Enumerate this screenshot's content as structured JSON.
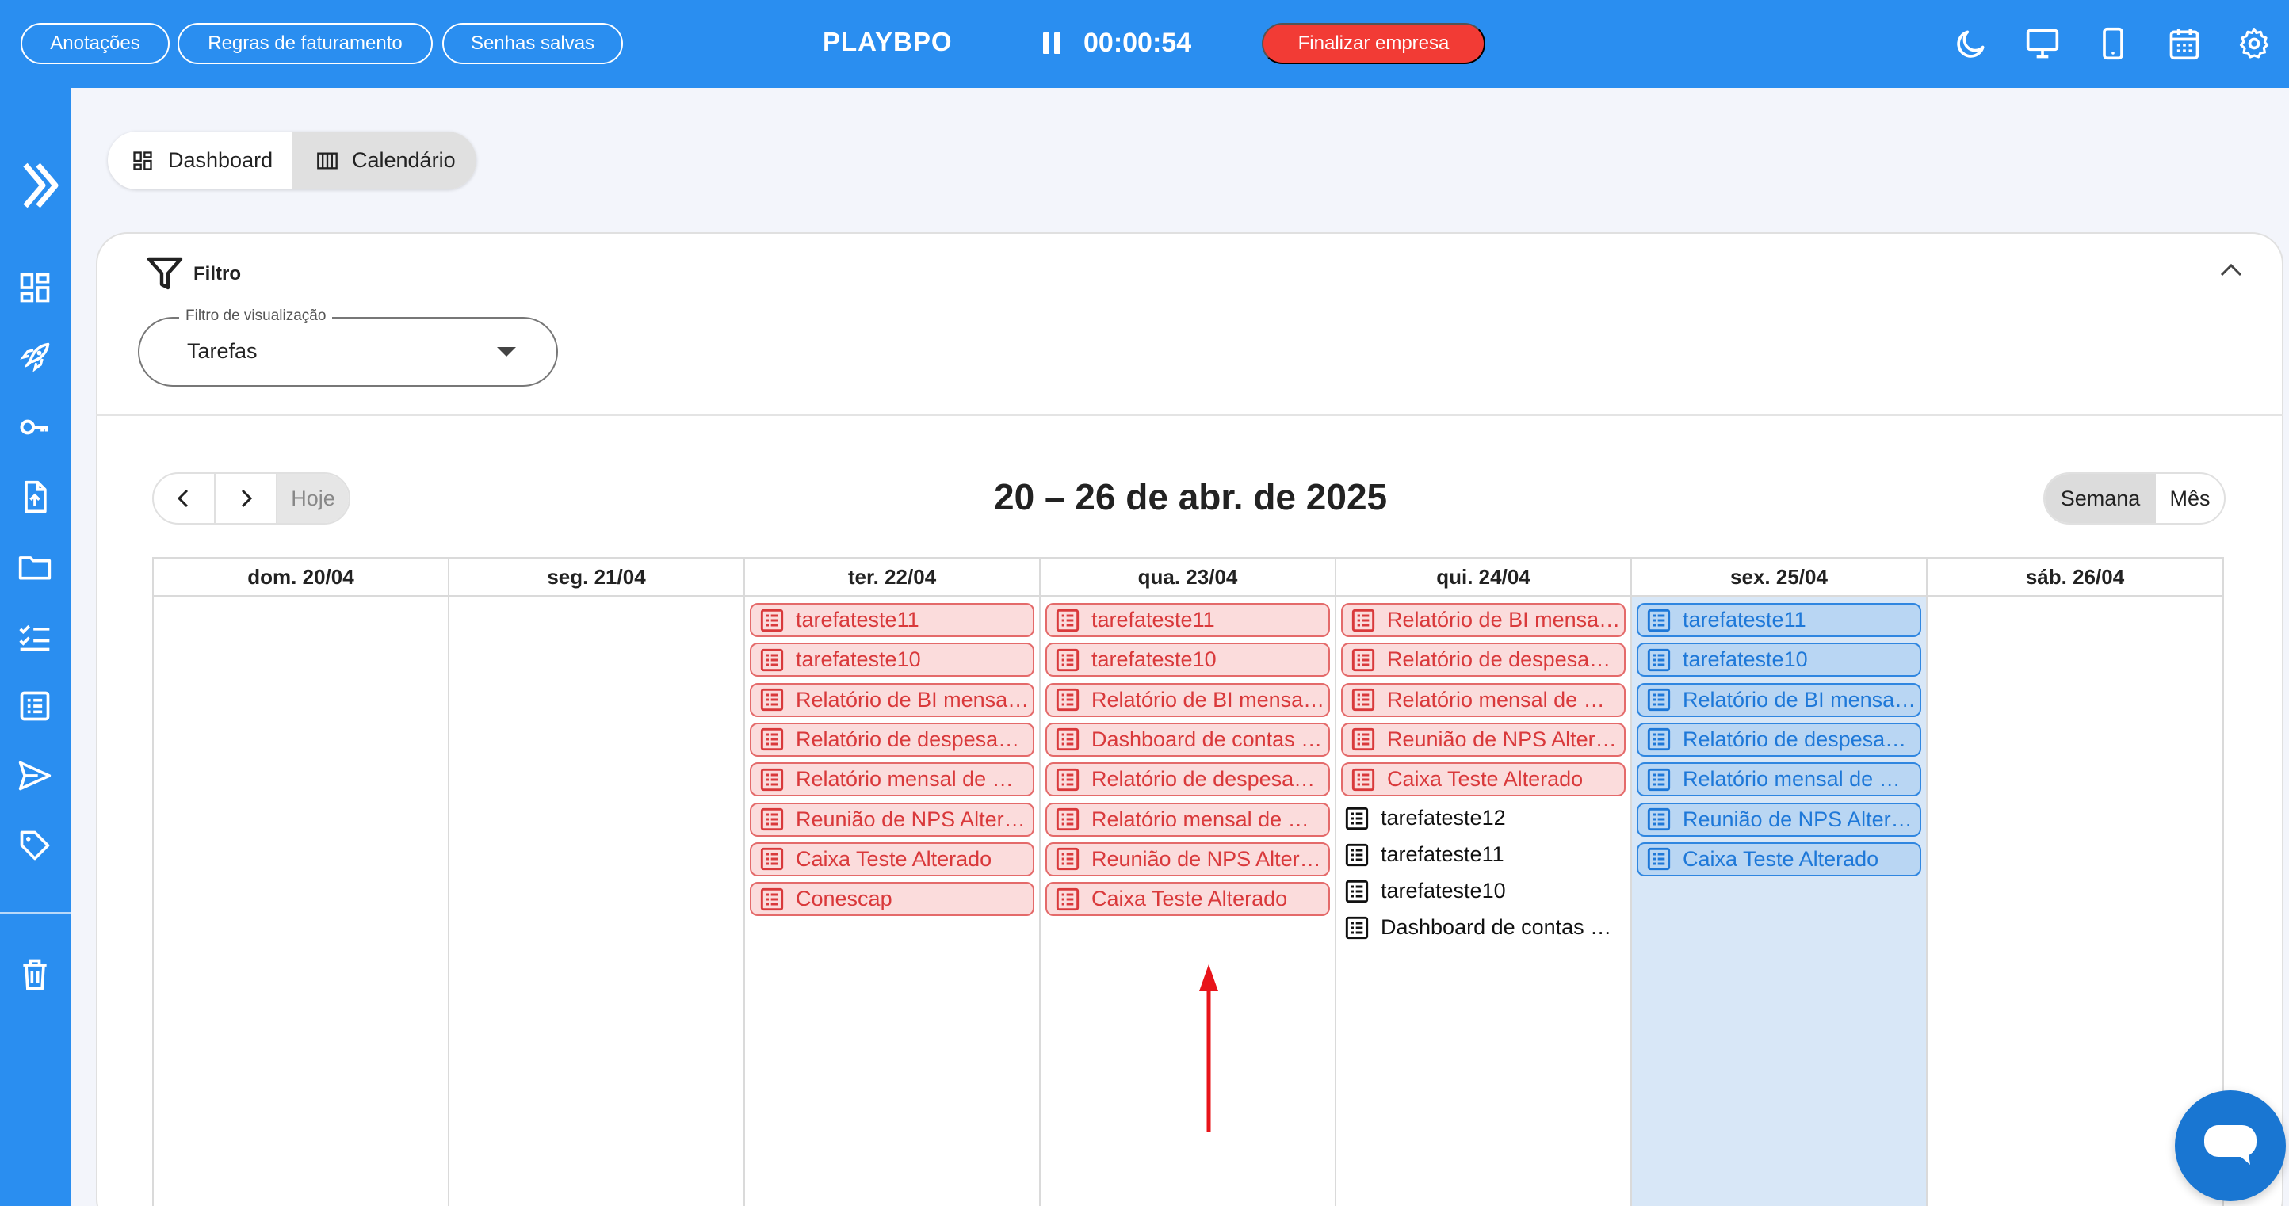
{
  "topbar": {
    "buttons": [
      {
        "label": "Anotações"
      },
      {
        "label": "Regras de faturamento"
      },
      {
        "label": "Senhas salvas"
      }
    ],
    "brand": "PLAYBPO",
    "timer": "00:00:54",
    "finalize_label": "Finalizar empresa",
    "icons": [
      "moon-icon",
      "monitor-icon",
      "phone-icon",
      "calendar-icon",
      "gear-icon"
    ]
  },
  "sidebar": {
    "icons": [
      "expand-chevron-icon",
      "dashboard-icon",
      "rocket-icon",
      "key-icon",
      "file-upload-icon",
      "folder-icon",
      "checklist-icon",
      "list-icon",
      "send-icon",
      "tag-icon",
      "trash-icon"
    ]
  },
  "view_toggle": {
    "dashboard_label": "Dashboard",
    "calendar_label": "Calendário",
    "active": "Calendário"
  },
  "filter": {
    "title": "Filtro",
    "select_label": "Filtro de visualização",
    "select_value": "Tarefas"
  },
  "calendar": {
    "today_label": "Hoje",
    "range_title": "20 – 26 de abr. de 2025",
    "view_week_label": "Semana",
    "view_month_label": "Mês",
    "active_view": "Semana",
    "colors": {
      "overdue": "#d9393b",
      "today": "#1e78d8",
      "pending": "#111111"
    },
    "days": [
      {
        "label": "dom. 20/04",
        "events": []
      },
      {
        "label": "seg. 21/04",
        "events": []
      },
      {
        "label": "ter. 22/04",
        "events": [
          {
            "title": "tarefateste11",
            "style": "red"
          },
          {
            "title": "tarefateste10",
            "style": "red"
          },
          {
            "title": "Relatório de BI mensa…",
            "style": "red"
          },
          {
            "title": "Relatório de despesa…",
            "style": "red"
          },
          {
            "title": "Relatório mensal de …",
            "style": "red"
          },
          {
            "title": "Reunião de NPS Alter…",
            "style": "red"
          },
          {
            "title": "Caixa Teste Alterado",
            "style": "red"
          },
          {
            "title": "Conescap",
            "style": "red"
          }
        ]
      },
      {
        "label": "qua. 23/04",
        "events": [
          {
            "title": "tarefateste11",
            "style": "red"
          },
          {
            "title": "tarefateste10",
            "style": "red"
          },
          {
            "title": "Relatório de BI mensa…",
            "style": "red"
          },
          {
            "title": "Dashboard de contas …",
            "style": "red"
          },
          {
            "title": "Relatório de despesa…",
            "style": "red"
          },
          {
            "title": "Relatório mensal de …",
            "style": "red"
          },
          {
            "title": "Reunião de NPS Alter…",
            "style": "red"
          },
          {
            "title": "Caixa Teste Alterado",
            "style": "red"
          }
        ]
      },
      {
        "label": "qui. 24/04",
        "events": [
          {
            "title": "Relatório de BI mensa…",
            "style": "red"
          },
          {
            "title": "Relatório de despesa…",
            "style": "red"
          },
          {
            "title": "Relatório mensal de …",
            "style": "red"
          },
          {
            "title": "Reunião de NPS Alter…",
            "style": "red"
          },
          {
            "title": "Caixa Teste Alterado",
            "style": "red"
          },
          {
            "title": "tarefateste12",
            "style": "plain"
          },
          {
            "title": "tarefateste11",
            "style": "plain"
          },
          {
            "title": "tarefateste10",
            "style": "plain"
          },
          {
            "title": "Dashboard de contas …",
            "style": "plain"
          }
        ]
      },
      {
        "label": "sex. 25/04",
        "highlight": true,
        "events": [
          {
            "title": "tarefateste11",
            "style": "blue"
          },
          {
            "title": "tarefateste10",
            "style": "blue"
          },
          {
            "title": "Relatório de BI mensa…",
            "style": "blue"
          },
          {
            "title": "Relatório de despesa…",
            "style": "blue"
          },
          {
            "title": "Relatório mensal de …",
            "style": "blue"
          },
          {
            "title": "Reunião de NPS Alter…",
            "style": "blue"
          },
          {
            "title": "Caixa Teste Alterado",
            "style": "blue"
          }
        ]
      },
      {
        "label": "sáb. 26/04",
        "events": []
      }
    ]
  }
}
